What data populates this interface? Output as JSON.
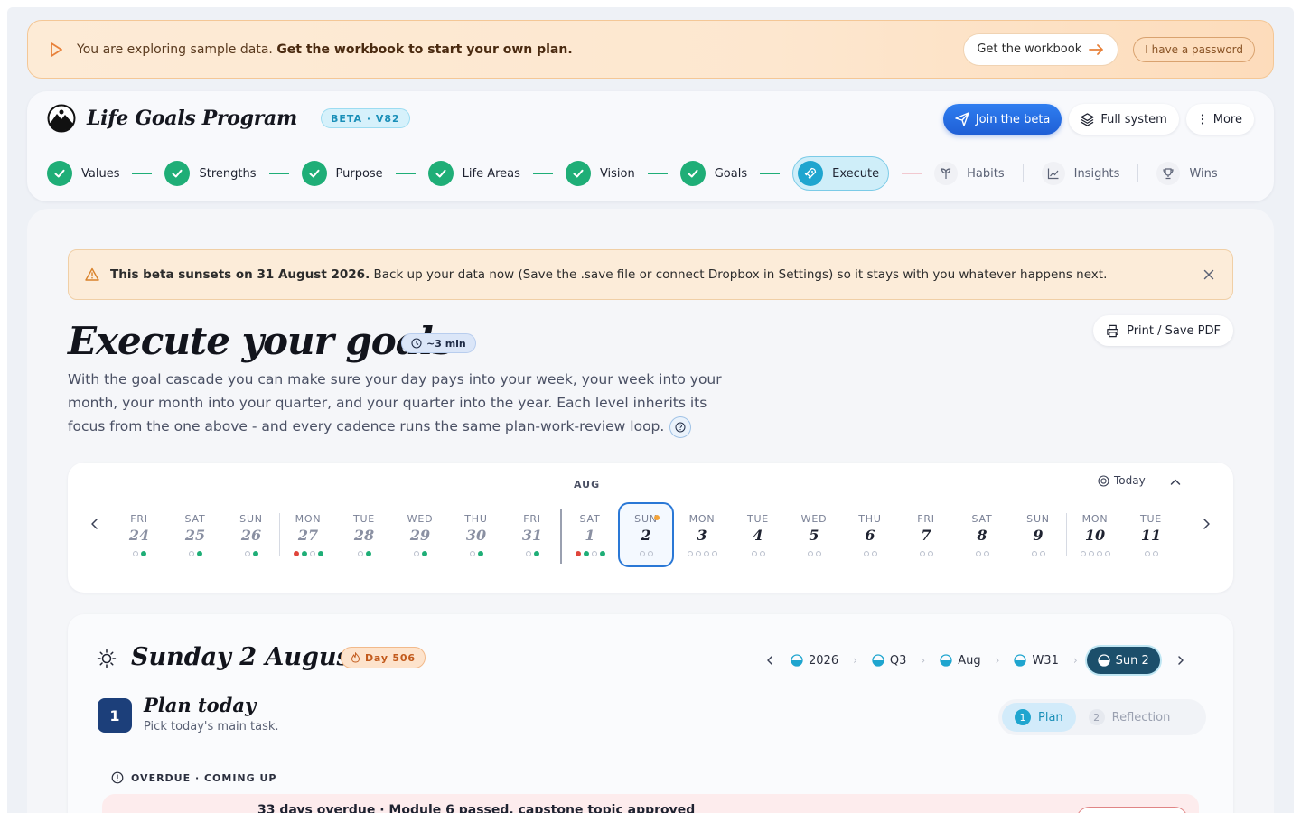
{
  "banner": {
    "text": "You are exploring sample data.",
    "text_strong": "Get the workbook to start your own plan.",
    "workbook_label": "Get the workbook",
    "password_label": "I have a password"
  },
  "header": {
    "brand": "Life Goals Program",
    "beta": "BETA · V82",
    "join_label": "Join the beta",
    "full_label": "Full system",
    "more_label": "More",
    "steps": [
      "Values",
      "Strengths",
      "Purpose",
      "Life Areas",
      "Vision",
      "Goals"
    ],
    "active_step": "Execute",
    "future_steps": [
      "Habits",
      "Insights",
      "Wins"
    ]
  },
  "sunset": {
    "strong": "This beta sunsets on 31 August 2026.",
    "text": " Back up your data now (Save the .save file or connect Dropbox in Settings) so it stays with you whatever happens next."
  },
  "page": {
    "title": "Execute your goals",
    "time": "~3 min",
    "print_label": "Print / Save PDF",
    "intro": "With the goal cascade you can make sure your day pays into your week, your week into your month, your month into your quarter, and your quarter into the year. Each level inherits its focus from the one above - and every cadence runs the same plan-work-review loop."
  },
  "calendar": {
    "month": "AUG",
    "today_label": "Today",
    "days": [
      {
        "dow": "FRI",
        "num": "24"
      },
      {
        "dow": "SAT",
        "num": "25"
      },
      {
        "dow": "SUN",
        "num": "26"
      },
      {
        "dow": "MON",
        "num": "27"
      },
      {
        "dow": "TUE",
        "num": "28"
      },
      {
        "dow": "WED",
        "num": "29"
      },
      {
        "dow": "THU",
        "num": "30"
      },
      {
        "dow": "FRI",
        "num": "31"
      },
      {
        "dow": "SAT",
        "num": "1"
      },
      {
        "dow": "SUN",
        "num": "2"
      },
      {
        "dow": "MON",
        "num": "3"
      },
      {
        "dow": "TUE",
        "num": "4"
      },
      {
        "dow": "WED",
        "num": "5"
      },
      {
        "dow": "THU",
        "num": "6"
      },
      {
        "dow": "FRI",
        "num": "7"
      },
      {
        "dow": "SAT",
        "num": "8"
      },
      {
        "dow": "SUN",
        "num": "9"
      },
      {
        "dow": "MON",
        "num": "10"
      },
      {
        "dow": "TUE",
        "num": "11"
      }
    ]
  },
  "day": {
    "title": "Sunday 2 August",
    "chip": "Day 506",
    "crumbs": [
      "2026",
      "Q3",
      "Aug",
      "W31"
    ],
    "crumb_active": "Sun 2",
    "step_num": "1",
    "plan_title": "Plan today",
    "plan_sub": "Pick today's main task.",
    "phase_plan": "Plan",
    "phase_reflection": "Reflection",
    "phase_plan_num": "1",
    "phase_reflection_num": "2",
    "overdue_head": "OVERDUE · COMING UP",
    "overdue_title": "33 days overdue · Module 6 passed, capstone topic approved"
  },
  "colors": {
    "accent": "#1fa5cf",
    "done": "#1fae77",
    "primary": "#1f5fd6",
    "warn": "#f2a33a"
  }
}
